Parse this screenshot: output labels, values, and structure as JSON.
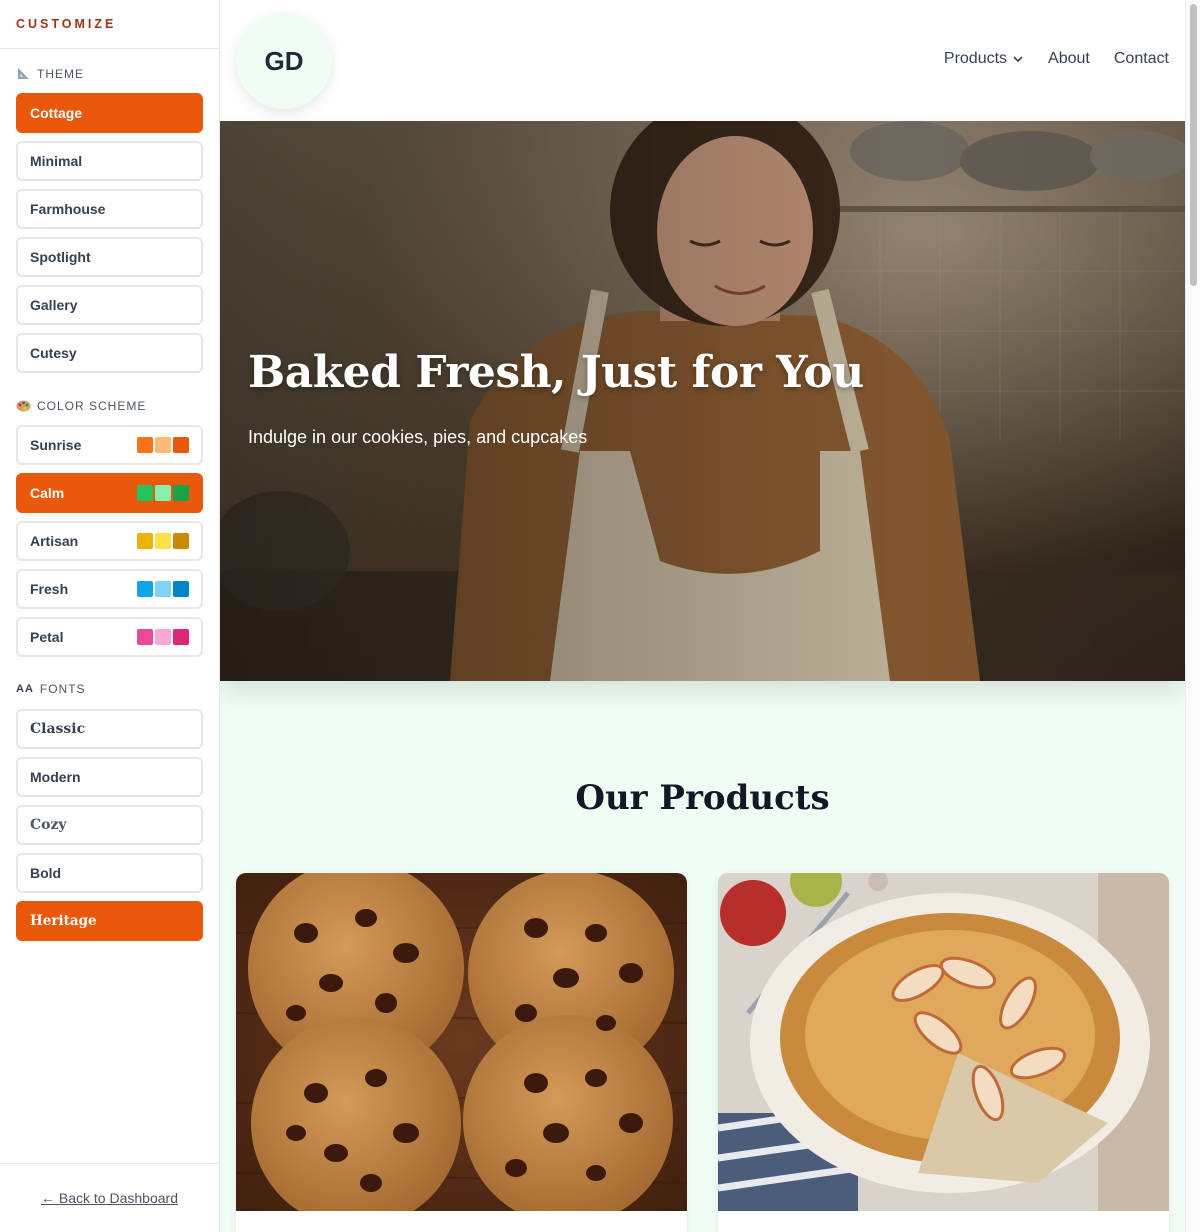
{
  "sidebar": {
    "title": "CUSTOMIZE",
    "theme_label": "THEME",
    "themes": [
      {
        "label": "Cottage",
        "active": true
      },
      {
        "label": "Minimal",
        "active": false
      },
      {
        "label": "Farmhouse",
        "active": false
      },
      {
        "label": "Spotlight",
        "active": false
      },
      {
        "label": "Gallery",
        "active": false
      },
      {
        "label": "Cutesy",
        "active": false
      }
    ],
    "color_label": "COLOR SCHEME",
    "colors": [
      {
        "label": "Sunrise",
        "active": false,
        "swatches": [
          "#f97316",
          "#fdba74",
          "#ea580c"
        ]
      },
      {
        "label": "Calm",
        "active": true,
        "swatches": [
          "#22c55e",
          "#86efac",
          "#16a34a"
        ]
      },
      {
        "label": "Artisan",
        "active": false,
        "swatches": [
          "#eab308",
          "#fde047",
          "#ca8a04"
        ]
      },
      {
        "label": "Fresh",
        "active": false,
        "swatches": [
          "#0ea5e9",
          "#7dd3fc",
          "#0284c7"
        ]
      },
      {
        "label": "Petal",
        "active": false,
        "swatches": [
          "#ec4899",
          "#f9a8d4",
          "#db2777"
        ]
      }
    ],
    "fonts_label": "FONTS",
    "fonts_icon_text": "AA",
    "fonts": [
      {
        "label": "Classic",
        "active": false
      },
      {
        "label": "Modern",
        "active": false
      },
      {
        "label": "Cozy",
        "active": false
      },
      {
        "label": "Bold",
        "active": false
      },
      {
        "label": "Heritage",
        "active": true
      }
    ],
    "back_link": "← Back to Dashboard"
  },
  "site": {
    "logo_text": "GD",
    "nav": {
      "products": "Products",
      "about": "About",
      "contact": "Contact"
    },
    "hero": {
      "title": "Baked Fresh, Just for You",
      "subtitle": "Indulge in our cookies, pies, and cupcakes"
    },
    "products_title": "Our Products"
  },
  "colors": {
    "accent": "#ea580c",
    "site_bg": "#f0fdf4",
    "heading": "#111827"
  }
}
